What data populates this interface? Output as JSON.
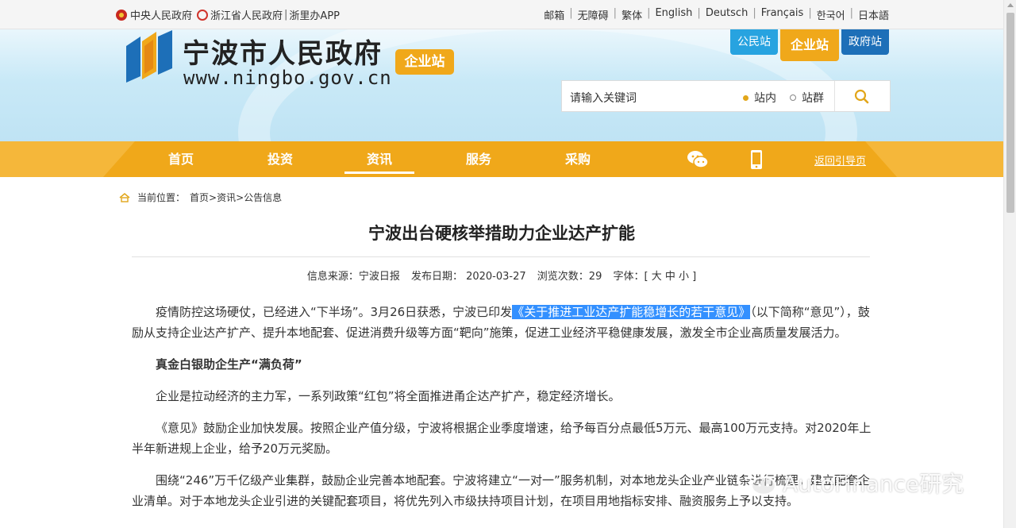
{
  "topbar": {
    "links_left": [
      "中央人民政府",
      "浙江省人民政府",
      "浙里办APP"
    ],
    "links_right": [
      "邮箱",
      "无障碍",
      "繁体",
      "English",
      "Deutsch",
      "Français",
      "한국어",
      "日本語"
    ]
  },
  "header": {
    "site_title": "宁波市人民政府",
    "site_url": "www.ningbo.gov.cn",
    "badge": "企业站",
    "station_tabs": [
      "公民站",
      "企业站",
      "政府站"
    ],
    "search": {
      "placeholder": "请输入关键词",
      "scope_options": [
        "站内",
        "站群"
      ],
      "selected_scope": "站内"
    }
  },
  "nav": {
    "items": [
      "首页",
      "投资",
      "资讯",
      "服务",
      "采购"
    ],
    "active": "资讯",
    "back_link": "返回引导页"
  },
  "breadcrumb": {
    "label": "当前位置：",
    "path": "首页>资讯>公告信息"
  },
  "article": {
    "title": "宁波出台硬核举措助力企业达产扩能",
    "meta": {
      "source": "信息来源：宁波日报",
      "date": "发布日期： 2020-03-27",
      "views": "浏览次数：29",
      "font": "字体：[ 大 中 小 ]"
    },
    "p1_before": "疫情防控这场硬仗，已经进入“下半场”。3月26日获悉，宁波已印发",
    "p1_highlight": "《关于推进工业达产扩能稳增长的若干意见》",
    "p1_after": "（以下简称“意见”），鼓励从支持企业达产扩产、提升本地配套、促进消费升级等方面“靶向”施策，促进工业经济平稳健康发展，激发全市企业高质量发展活力。",
    "heading1": "真金白银助企生产“满负荷”",
    "p2": "企业是拉动经济的主力军，一系列政策“红包”将全面推进甬企达产扩产，稳定经济增长。",
    "p3": "《意见》鼓励企业加快发展。按照企业产值分级，宁波将根据企业季度增速，给予每百分点最低5万元、最高100万元支持。对2020年上半年新进规上企业，给予20万元奖励。",
    "p4": "围绕“246”万千亿级产业集群，鼓励企业完善本地配套。宁波将建立“一对一”服务机制，对本地龙头企业产业链条进行梳理，建立配套企业清单。对于本地龙头企业引进的关键配套项目，将优先列入市级扶持项目计划，在项目用地指标安排、融资服务上予以支持。"
  },
  "watermark": "AutoFinance研究",
  "colors": {
    "nav": "#f0a81a",
    "highlight": "#3390ff",
    "gmz_tab": "#27a3e0",
    "zfz_tab": "#1d6fb8"
  }
}
